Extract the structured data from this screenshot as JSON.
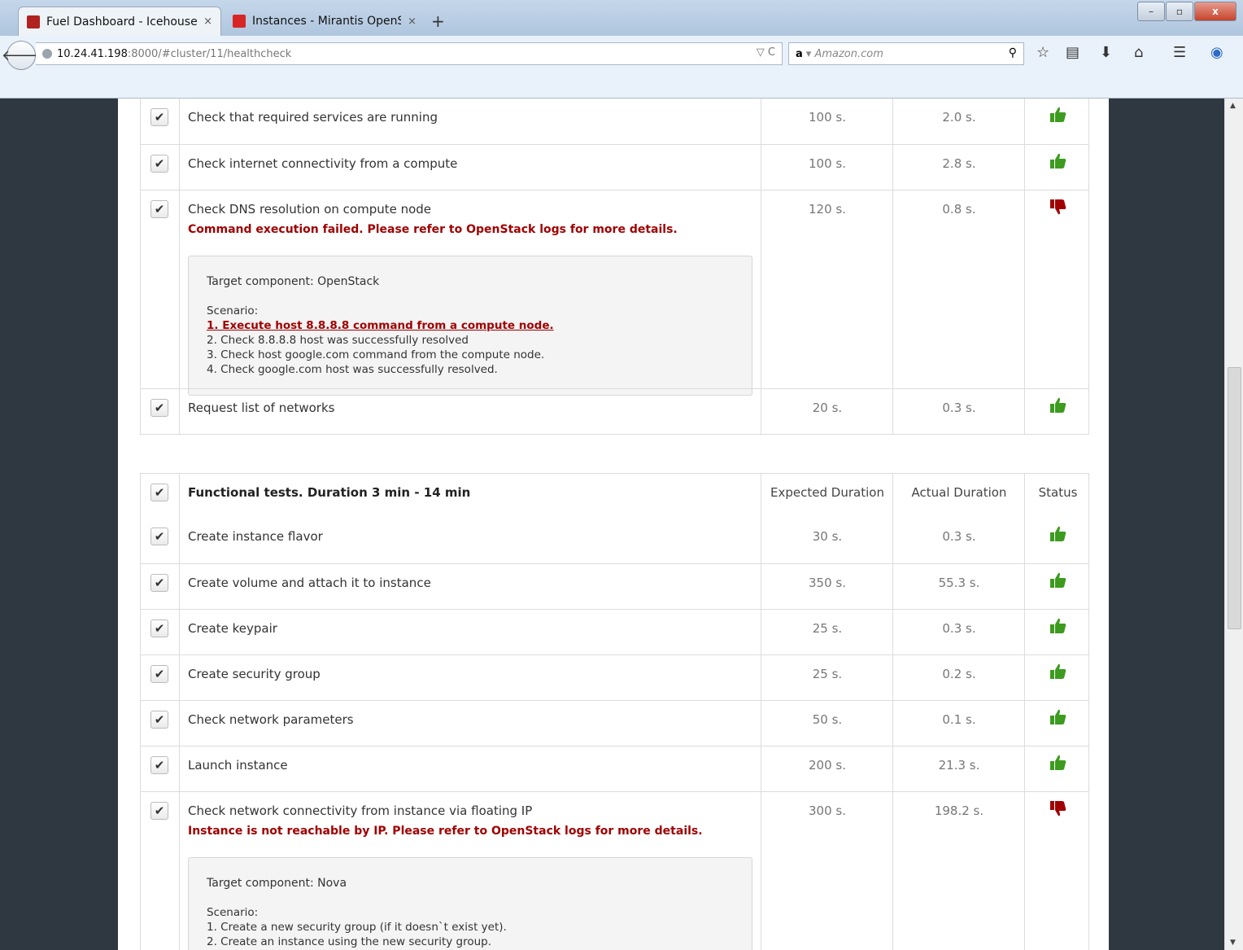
{
  "browser": {
    "tabs": [
      {
        "title": "Fuel Dashboard - Icehouse ...",
        "active": true
      },
      {
        "title": "Instances - Mirantis OpenS...",
        "active": false
      }
    ],
    "tab_close": "×",
    "new_tab": "+",
    "window_controls": {
      "minimize": "–",
      "maximize": "▫",
      "close": "x"
    },
    "url_host": "10.24.41.198",
    "url_rest": ":8000/#cluster/11/healthcheck",
    "url_controls": "▽ C",
    "search_engine": "a",
    "search_placeholder": "▾ Amazon.com"
  },
  "colors": {
    "pass": "#3d9b1f",
    "fail": "#a00000"
  },
  "group1": {
    "rows": [
      {
        "name": "Check that required services are running",
        "expected": "100 s.",
        "actual": "2.0 s.",
        "status": "pass"
      },
      {
        "name": "Check internet connectivity from a compute",
        "expected": "100 s.",
        "actual": "2.8 s.",
        "status": "pass"
      },
      {
        "name": "Check DNS resolution on compute node",
        "expected": "120 s.",
        "actual": "0.8 s.",
        "status": "fail",
        "error": "Command execution failed. Please refer to OpenStack logs for more details.",
        "target": "Target component: OpenStack",
        "scenario_label": "Scenario:",
        "steps": [
          "1. Execute host 8.8.8.8 command from a compute node.",
          "2. Check 8.8.8.8 host was successfully resolved",
          "3. Check host google.com command from the compute node.",
          "4. Check google.com host was successfully resolved."
        ]
      },
      {
        "name": "Request list of networks",
        "expected": "20 s.",
        "actual": "0.3 s.",
        "status": "pass"
      }
    ]
  },
  "group2": {
    "header": {
      "title": "Functional tests. Duration 3 min - 14 min",
      "expected": "Expected Duration",
      "actual": "Actual Duration",
      "status": "Status"
    },
    "rows": [
      {
        "name": "Create instance flavor",
        "expected": "30 s.",
        "actual": "0.3 s.",
        "status": "pass"
      },
      {
        "name": "Create volume and attach it to instance",
        "expected": "350 s.",
        "actual": "55.3 s.",
        "status": "pass"
      },
      {
        "name": "Create keypair",
        "expected": "25 s.",
        "actual": "0.3 s.",
        "status": "pass"
      },
      {
        "name": "Create security group",
        "expected": "25 s.",
        "actual": "0.2 s.",
        "status": "pass"
      },
      {
        "name": "Check network parameters",
        "expected": "50 s.",
        "actual": "0.1 s.",
        "status": "pass"
      },
      {
        "name": "Launch instance",
        "expected": "200 s.",
        "actual": "21.3 s.",
        "status": "pass"
      },
      {
        "name": "Check network connectivity from instance via floating IP",
        "expected": "300 s.",
        "actual": "198.2 s.",
        "status": "fail",
        "error": "Instance is not reachable by IP. Please refer to OpenStack logs for more details.",
        "target": "Target component: Nova",
        "scenario_label": "Scenario:",
        "steps": [
          "1. Create a new security group (if it doesn`t exist yet).",
          "2. Create an instance using the new security group."
        ]
      }
    ]
  }
}
